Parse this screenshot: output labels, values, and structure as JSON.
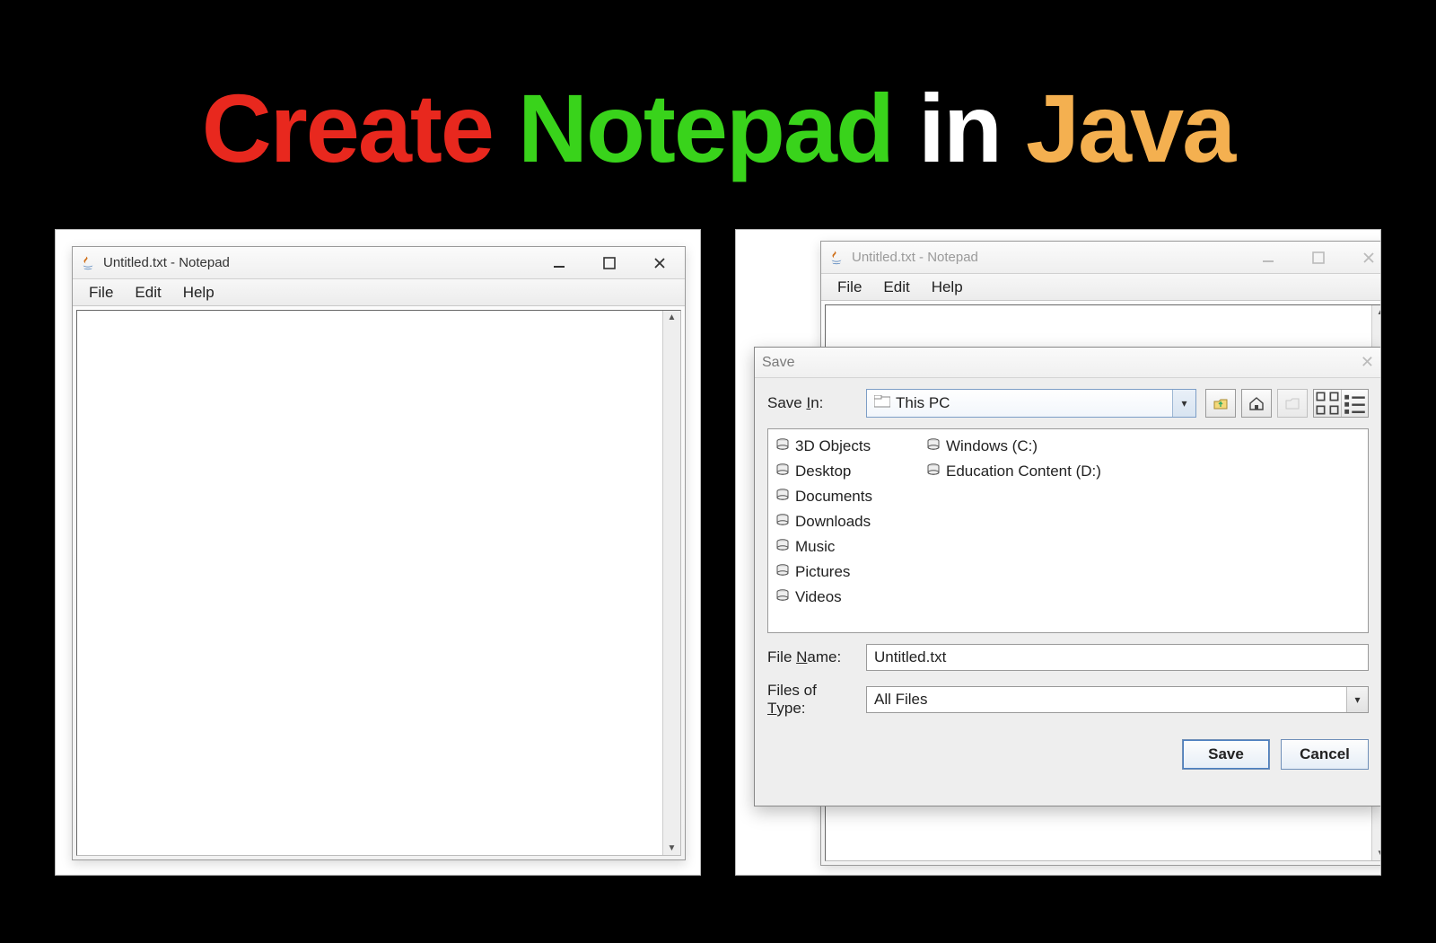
{
  "heading": {
    "w1": "Create",
    "w2": "Notepad",
    "w3": "in",
    "w4": "Java"
  },
  "left_window": {
    "title": "Untitled.txt - Notepad",
    "menu": {
      "file": "File",
      "edit": "Edit",
      "help": "Help"
    }
  },
  "right_window": {
    "title": "Untitled.txt - Notepad",
    "menu": {
      "file": "File",
      "edit": "Edit",
      "help": "Help"
    }
  },
  "save_dialog": {
    "title": "Save",
    "save_in_label": "Save In:",
    "save_in_value": "This PC",
    "items_col1": [
      "3D Objects",
      "Desktop",
      "Documents",
      "Downloads",
      "Music",
      "Pictures",
      "Videos",
      "Windows (C:)"
    ],
    "items_col2": [
      "Education Content (D:)"
    ],
    "file_name_label": "File Name:",
    "file_name_value": "Untitled.txt",
    "file_type_label": "Files of Type:",
    "file_type_value": "All Files",
    "save_btn": "Save",
    "cancel_btn": "Cancel"
  }
}
